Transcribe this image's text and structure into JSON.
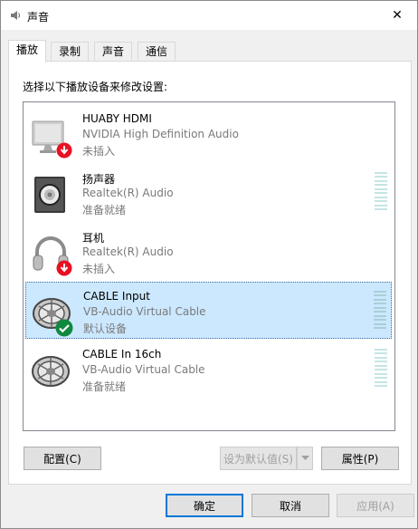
{
  "window": {
    "title": "声音",
    "close_glyph": "✕"
  },
  "tabs": [
    {
      "label": "播放",
      "active": true
    },
    {
      "label": "录制",
      "active": false
    },
    {
      "label": "声音",
      "active": false
    },
    {
      "label": "通信",
      "active": false
    }
  ],
  "instruction": "选择以下播放设备来修改设置:",
  "devices": [
    {
      "name": "HUABY  HDMI",
      "driver": "NVIDIA High Definition Audio",
      "status": "未插入",
      "icon": "monitor-icon",
      "badge": "unplugged-badge-icon"
    },
    {
      "name": "扬声器",
      "driver": "Realtek(R) Audio",
      "status": "准备就绪",
      "icon": "speaker-icon",
      "badge": ""
    },
    {
      "name": "耳机",
      "driver": "Realtek(R) Audio",
      "status": "未插入",
      "icon": "headphones-icon",
      "badge": "unplugged-badge-icon"
    },
    {
      "name": "CABLE Input",
      "driver": "VB-Audio Virtual Cable",
      "status": "默认设备",
      "icon": "cable-icon",
      "badge": "default-check-icon",
      "selected": true
    },
    {
      "name": "CABLE In 16ch",
      "driver": "VB-Audio Virtual Cable",
      "status": "准备就绪",
      "icon": "cable-icon",
      "badge": ""
    }
  ],
  "buttons": {
    "configure": "配置(C)",
    "set_default": "设为默认值(S)",
    "properties": "属性(P)",
    "ok": "确定",
    "cancel": "取消",
    "apply": "应用(A)"
  },
  "colors": {
    "selection": "#cce8ff",
    "accent": "#0078d7",
    "meter": "#c5e4e6",
    "unplugged": "#e81123",
    "default_check": "#10893e"
  }
}
